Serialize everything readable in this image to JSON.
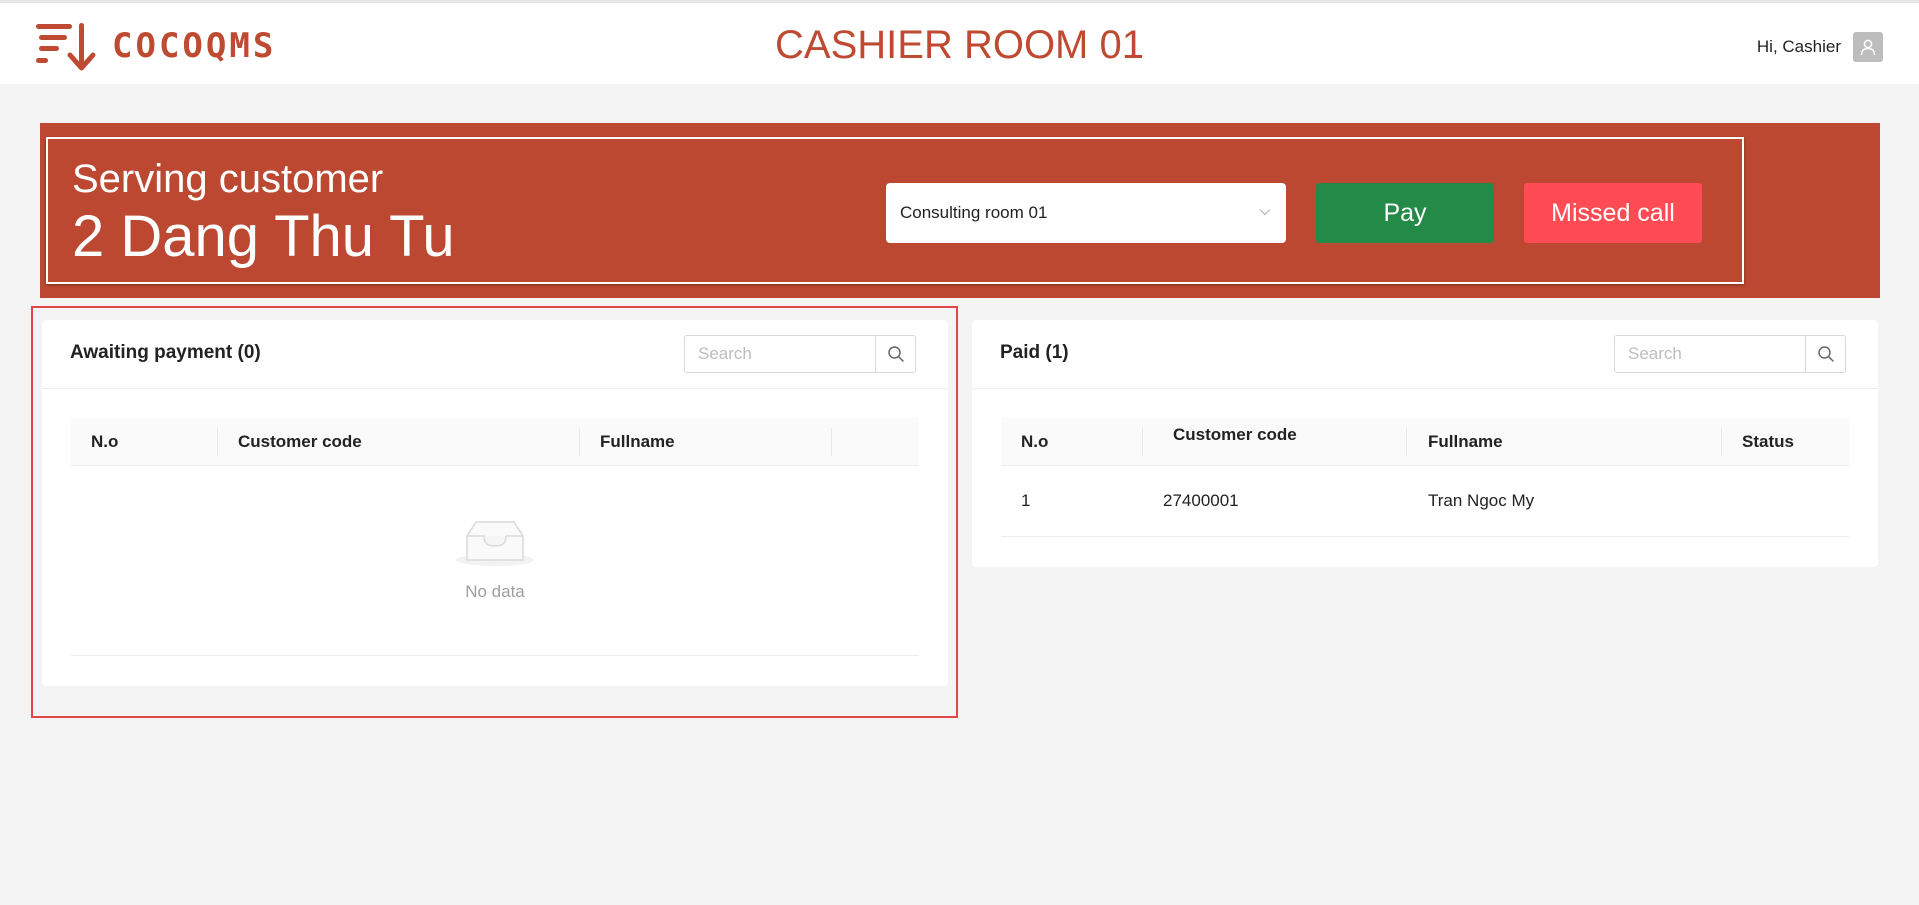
{
  "header": {
    "logo_text": "COCOQMS",
    "room_title": "CASHIER ROOM 01",
    "greeting": "Hi, Cashier",
    "avatar_icon": "user-icon"
  },
  "banner": {
    "serving_label": "Serving customer",
    "serving_name": "2 Dang Thu Tu",
    "room_select": {
      "selected": "Consulting room 01",
      "icon": "chevron-down-icon"
    },
    "pay_label": "Pay",
    "missed_label": "Missed call",
    "colors": {
      "banner": "#bc4832",
      "pay": "#238a48",
      "missed": "#ff4b53"
    }
  },
  "awaiting": {
    "title": "Awaiting payment (0)",
    "search_placeholder": "Search",
    "columns": [
      "N.o",
      "Customer code",
      "Fullname",
      ""
    ],
    "rows": [],
    "empty_text": "No data"
  },
  "paid": {
    "title": "Paid (1)",
    "search_placeholder": "Search",
    "columns": [
      "N.o",
      "Customer code",
      "Fullname",
      "Status"
    ],
    "rows": [
      {
        "no": "1",
        "code": "27400001",
        "fullname": "Tran Ngoc My",
        "status": ""
      }
    ]
  }
}
